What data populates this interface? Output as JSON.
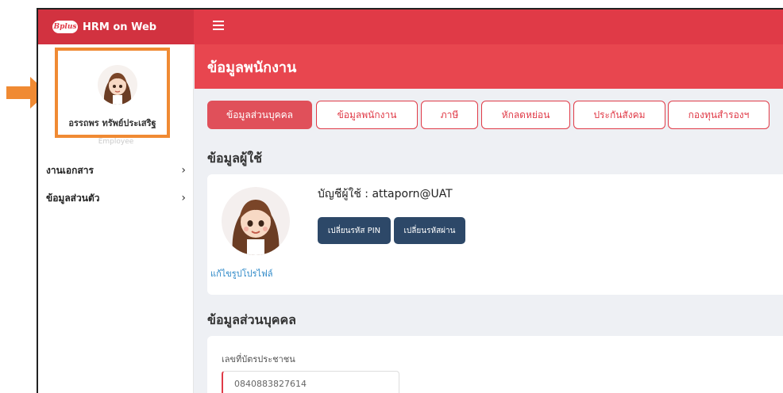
{
  "app": {
    "logo_text": "Bplus",
    "name": "HRM on Web"
  },
  "sidebar": {
    "user_name": "อรรถพร ทรัพย์ประเสริฐ",
    "user_role": "Employee",
    "items": [
      {
        "label": "งานเอกสาร",
        "chevron": "›"
      },
      {
        "label": "ข้อมูลส่วนตัว",
        "chevron": "›"
      }
    ]
  },
  "page": {
    "title": "ข้อมูลพนักงาน"
  },
  "tabs": [
    {
      "label": "ข้อมูลส่วนบุคคล",
      "active": true
    },
    {
      "label": "ข้อมูลพนักงาน",
      "active": false
    },
    {
      "label": "ภาษี",
      "active": false
    },
    {
      "label": "หักลดหย่อน",
      "active": false
    },
    {
      "label": "ประกันสังคม",
      "active": false
    },
    {
      "label": "กองทุนสำรองฯ",
      "active": false
    }
  ],
  "user_section": {
    "title": "ข้อมูลผู้ใช้",
    "account_label": "บัญชีผู้ใช้ : attaporn@UAT",
    "change_pin_button": "เปลี่ยนรหัส PIN",
    "change_password_button": "เปลี่ยนรหัสผ่าน",
    "edit_photo_link": "แก้ไขรูปโปรไฟล์"
  },
  "personal_section": {
    "title": "ข้อมูลส่วนบุคคล",
    "id_card_label": "เลขที่บัตรประชาชน",
    "id_card_value": "0840883827614"
  },
  "colors": {
    "topbar": "#e03a47",
    "header": "#e8464f",
    "accent_button": "#2d4868",
    "highlight_box": "#f08a33",
    "link": "#2e89c8"
  }
}
